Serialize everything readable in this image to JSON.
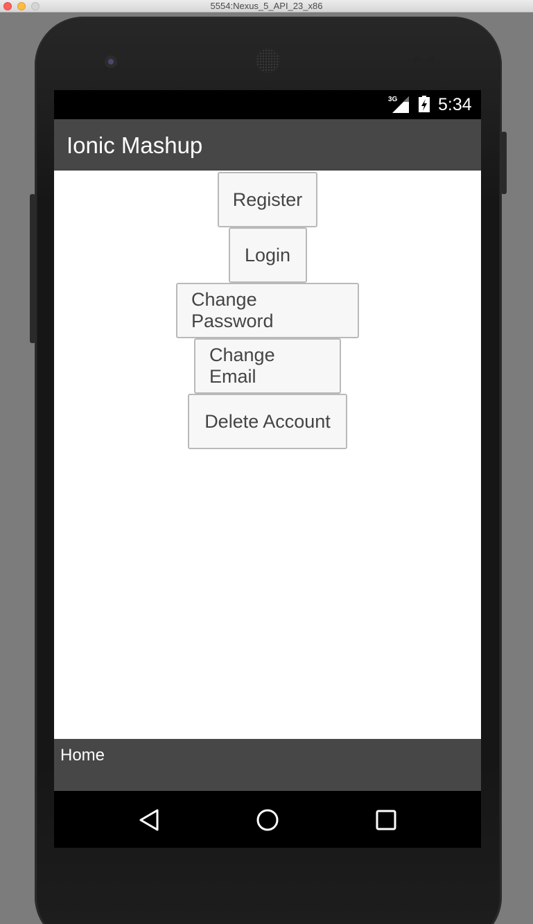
{
  "window": {
    "title": "5554:Nexus_5_API_23_x86"
  },
  "status_bar": {
    "network": "3G",
    "time": "5:34"
  },
  "app_bar": {
    "title": "Ionic Mashup"
  },
  "buttons": [
    {
      "label": "Register"
    },
    {
      "label": "Login"
    },
    {
      "label": "Change Password"
    },
    {
      "label": "Change Email"
    },
    {
      "label": "Delete Account"
    }
  ],
  "footer": {
    "label": "Home"
  },
  "nav": {
    "back_icon": "back-triangle-icon",
    "home_icon": "home-circle-icon",
    "recents_icon": "recents-square-icon"
  },
  "colors": {
    "app_bar": "#474747",
    "footer": "#474747",
    "button_bg": "#f7f7f7",
    "button_border": "#b9b9b9"
  }
}
